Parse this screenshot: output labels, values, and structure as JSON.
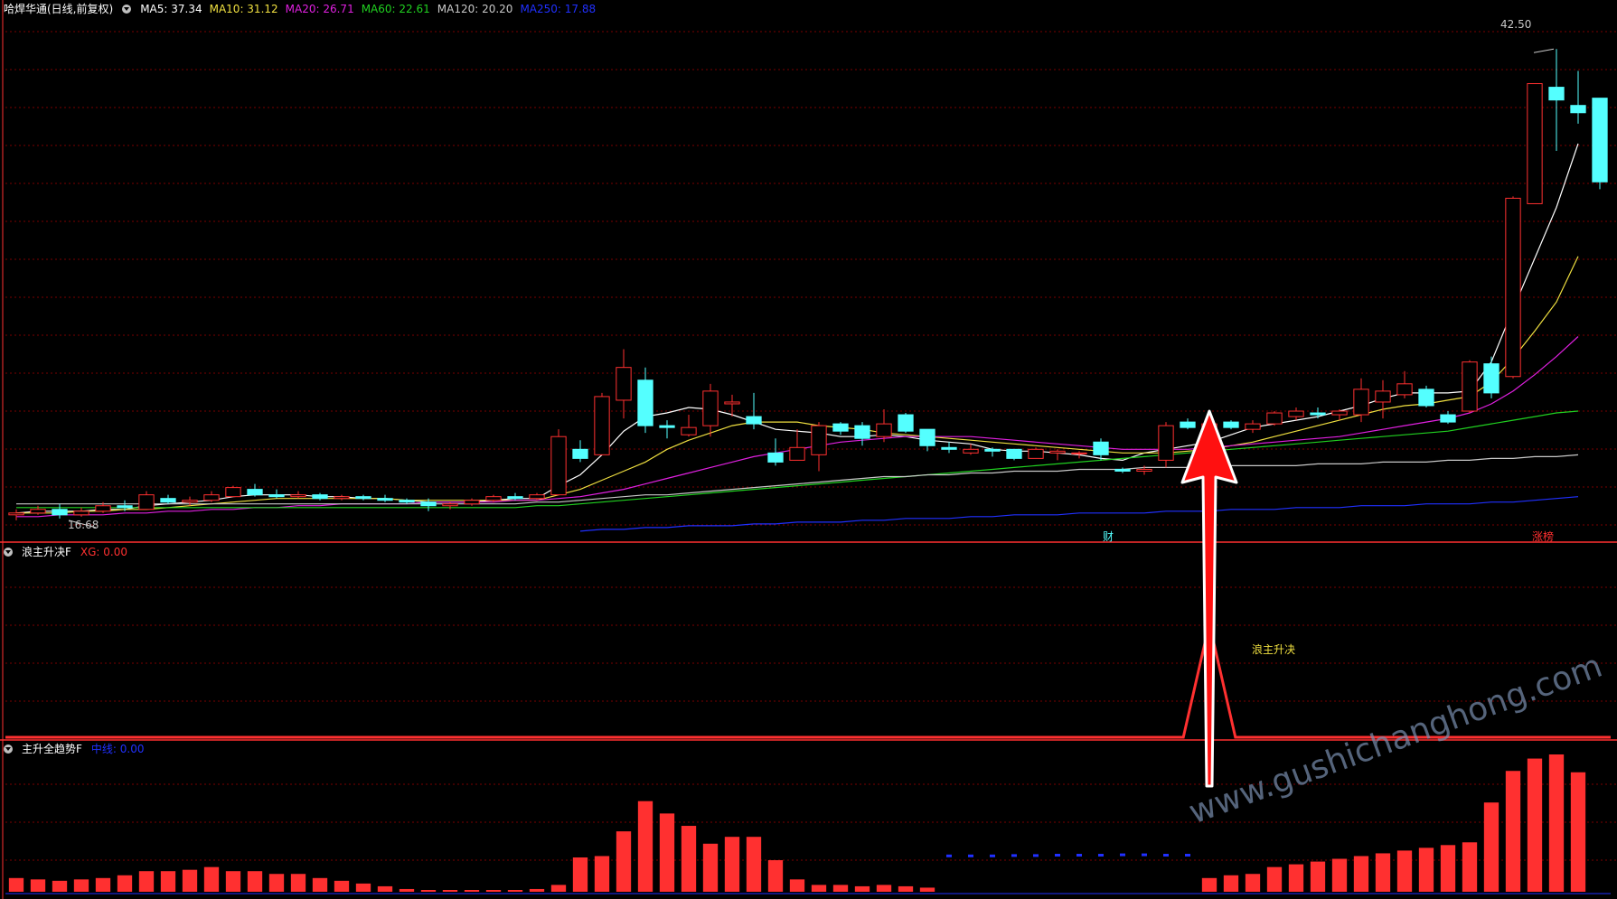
{
  "header": {
    "title": "哈焊华通(日线,前复权)",
    "ma_items": [
      {
        "label": "MA5: 37.34",
        "color": "#ffffff"
      },
      {
        "label": "MA10: 31.12",
        "color": "#f0e040"
      },
      {
        "label": "MA20: 26.71",
        "color": "#e020e0"
      },
      {
        "label": "MA60: 22.61",
        "color": "#20d020"
      },
      {
        "label": "MA120: 20.20",
        "color": "#c8c8c8"
      },
      {
        "label": "MA250: 17.88",
        "color": "#2030ff"
      }
    ]
  },
  "indicator1": {
    "name": "浪主升决F",
    "value_label": "XG: 0.00",
    "signal_text": "浪主升决"
  },
  "indicator2": {
    "name": "主升全趋势F",
    "value_label": "中线: 0.00"
  },
  "annotations": {
    "high_label": "42.50",
    "low_label": "16.68",
    "marker_cai": "财",
    "marker_zhangbang": "涨榜"
  },
  "watermark": "www.gushichanghong.com",
  "colors": {
    "up": "#ff3030",
    "down": "#54ffff",
    "grid": "#7a0000",
    "bg": "#000000"
  },
  "chart_data": {
    "type": "candlestick",
    "price_range": [
      15.5,
      44.5
    ],
    "candles": [
      {
        "o": 16.9,
        "h": 17.2,
        "l": 16.6,
        "c": 17.0
      },
      {
        "o": 17.0,
        "h": 17.4,
        "l": 16.9,
        "c": 17.2
      },
      {
        "o": 17.2,
        "h": 17.5,
        "l": 16.7,
        "c": 16.9
      },
      {
        "o": 16.9,
        "h": 17.3,
        "l": 16.8,
        "c": 17.1
      },
      {
        "o": 17.1,
        "h": 17.6,
        "l": 17.0,
        "c": 17.4
      },
      {
        "o": 17.4,
        "h": 17.7,
        "l": 17.1,
        "c": 17.3
      },
      {
        "o": 17.2,
        "h": 18.2,
        "l": 17.2,
        "c": 18.0
      },
      {
        "o": 17.8,
        "h": 18.0,
        "l": 17.5,
        "c": 17.6
      },
      {
        "o": 17.6,
        "h": 17.9,
        "l": 17.4,
        "c": 17.7
      },
      {
        "o": 17.7,
        "h": 18.2,
        "l": 17.6,
        "c": 18.0
      },
      {
        "o": 17.9,
        "h": 18.5,
        "l": 17.9,
        "c": 18.4
      },
      {
        "o": 18.3,
        "h": 18.6,
        "l": 17.9,
        "c": 18.0
      },
      {
        "o": 18.0,
        "h": 18.3,
        "l": 17.8,
        "c": 17.9
      },
      {
        "o": 17.9,
        "h": 18.2,
        "l": 17.8,
        "c": 18.0
      },
      {
        "o": 18.0,
        "h": 18.1,
        "l": 17.7,
        "c": 17.8
      },
      {
        "o": 17.8,
        "h": 18.0,
        "l": 17.7,
        "c": 17.9
      },
      {
        "o": 17.9,
        "h": 18.0,
        "l": 17.7,
        "c": 17.8
      },
      {
        "o": 17.8,
        "h": 18.0,
        "l": 17.6,
        "c": 17.7
      },
      {
        "o": 17.7,
        "h": 17.8,
        "l": 17.5,
        "c": 17.6
      },
      {
        "o": 17.6,
        "h": 17.8,
        "l": 17.1,
        "c": 17.4
      },
      {
        "o": 17.4,
        "h": 17.6,
        "l": 17.2,
        "c": 17.5
      },
      {
        "o": 17.5,
        "h": 17.8,
        "l": 17.4,
        "c": 17.7
      },
      {
        "o": 17.7,
        "h": 18.0,
        "l": 17.6,
        "c": 17.9
      },
      {
        "o": 17.9,
        "h": 18.1,
        "l": 17.7,
        "c": 17.8
      },
      {
        "o": 17.8,
        "h": 18.1,
        "l": 17.7,
        "c": 18.0
      },
      {
        "o": 18.0,
        "h": 21.6,
        "l": 18.0,
        "c": 21.2
      },
      {
        "o": 20.5,
        "h": 21.0,
        "l": 19.8,
        "c": 20.0
      },
      {
        "o": 20.2,
        "h": 23.6,
        "l": 20.2,
        "c": 23.4
      },
      {
        "o": 23.2,
        "h": 26.0,
        "l": 22.2,
        "c": 25.0
      },
      {
        "o": 24.3,
        "h": 25.0,
        "l": 21.4,
        "c": 21.8
      },
      {
        "o": 21.8,
        "h": 22.1,
        "l": 21.1,
        "c": 21.7
      },
      {
        "o": 21.3,
        "h": 22.4,
        "l": 21.2,
        "c": 21.7
      },
      {
        "o": 21.8,
        "h": 24.1,
        "l": 21.2,
        "c": 23.7
      },
      {
        "o": 23.0,
        "h": 23.5,
        "l": 22.3,
        "c": 23.1
      },
      {
        "o": 22.3,
        "h": 23.6,
        "l": 21.6,
        "c": 21.9
      },
      {
        "o": 20.3,
        "h": 21.1,
        "l": 19.6,
        "c": 19.8
      },
      {
        "o": 19.9,
        "h": 21.6,
        "l": 19.9,
        "c": 20.6
      },
      {
        "o": 20.2,
        "h": 22.0,
        "l": 19.3,
        "c": 21.8
      },
      {
        "o": 21.9,
        "h": 22.0,
        "l": 21.3,
        "c": 21.5
      },
      {
        "o": 21.8,
        "h": 22.0,
        "l": 20.7,
        "c": 21.1
      },
      {
        "o": 21.2,
        "h": 22.7,
        "l": 20.9,
        "c": 21.9
      },
      {
        "o": 22.4,
        "h": 22.5,
        "l": 21.4,
        "c": 21.5
      },
      {
        "o": 21.6,
        "h": 21.6,
        "l": 20.4,
        "c": 20.7
      },
      {
        "o": 20.6,
        "h": 20.9,
        "l": 20.3,
        "c": 20.5
      },
      {
        "o": 20.3,
        "h": 20.8,
        "l": 20.2,
        "c": 20.5
      },
      {
        "o": 20.5,
        "h": 20.6,
        "l": 20.1,
        "c": 20.4
      },
      {
        "o": 20.5,
        "h": 20.5,
        "l": 19.9,
        "c": 20.0
      },
      {
        "o": 20.0,
        "h": 20.6,
        "l": 20.0,
        "c": 20.5
      },
      {
        "o": 20.3,
        "h": 20.5,
        "l": 19.9,
        "c": 20.4
      },
      {
        "o": 20.3,
        "h": 20.4,
        "l": 20.0,
        "c": 20.3
      },
      {
        "o": 20.9,
        "h": 21.1,
        "l": 19.9,
        "c": 20.2
      },
      {
        "o": 19.4,
        "h": 19.5,
        "l": 19.2,
        "c": 19.3
      },
      {
        "o": 19.3,
        "h": 19.6,
        "l": 19.1,
        "c": 19.4
      },
      {
        "o": 19.9,
        "h": 22.0,
        "l": 19.5,
        "c": 21.8
      },
      {
        "o": 22.0,
        "h": 22.2,
        "l": 21.6,
        "c": 21.7
      },
      {
        "o": 21.3,
        "h": 22.0,
        "l": 21.1,
        "c": 21.9
      },
      {
        "o": 22.0,
        "h": 22.1,
        "l": 21.6,
        "c": 21.7
      },
      {
        "o": 21.6,
        "h": 22.1,
        "l": 21.4,
        "c": 21.9
      },
      {
        "o": 21.9,
        "h": 22.6,
        "l": 21.8,
        "c": 22.5
      },
      {
        "o": 22.3,
        "h": 22.8,
        "l": 22.1,
        "c": 22.6
      },
      {
        "o": 22.5,
        "h": 22.8,
        "l": 22.2,
        "c": 22.4
      },
      {
        "o": 22.4,
        "h": 22.7,
        "l": 22.1,
        "c": 22.6
      },
      {
        "o": 22.4,
        "h": 24.4,
        "l": 22.0,
        "c": 23.8
      },
      {
        "o": 23.1,
        "h": 24.3,
        "l": 22.2,
        "c": 23.7
      },
      {
        "o": 23.5,
        "h": 24.8,
        "l": 23.3,
        "c": 24.1
      },
      {
        "o": 23.8,
        "h": 24.0,
        "l": 22.8,
        "c": 22.9
      },
      {
        "o": 22.4,
        "h": 22.6,
        "l": 21.9,
        "c": 22.0
      },
      {
        "o": 22.6,
        "h": 25.4,
        "l": 22.5,
        "c": 25.3
      },
      {
        "o": 25.2,
        "h": 25.6,
        "l": 23.3,
        "c": 23.6
      },
      {
        "o": 24.5,
        "h": 34.4,
        "l": 24.4,
        "c": 34.3
      },
      {
        "o": 34.0,
        "h": 38.4,
        "l": 37.7,
        "c": 40.6
      },
      {
        "o": 40.4,
        "h": 42.5,
        "l": 36.9,
        "c": 39.7
      },
      {
        "o": 39.4,
        "h": 41.3,
        "l": 38.4,
        "c": 39.0
      },
      {
        "o": 39.8,
        "h": 39.8,
        "l": 34.8,
        "c": 35.2
      }
    ],
    "ma_lines": [
      {
        "name": "MA5",
        "color": "#ffffff",
        "values": [
          17.0,
          17.1,
          17.1,
          17.1,
          17.2,
          17.2,
          17.4,
          17.5,
          17.6,
          17.7,
          17.9,
          18.0,
          18.0,
          18.0,
          17.9,
          17.9,
          17.8,
          17.8,
          17.7,
          17.6,
          17.6,
          17.6,
          17.7,
          17.8,
          17.8,
          18.5,
          19.1,
          20.2,
          21.5,
          22.3,
          22.5,
          22.8,
          22.7,
          22.4,
          22.0,
          21.6,
          21.5,
          21.4,
          21.2,
          21.2,
          21.3,
          21.2,
          21.0,
          20.9,
          20.8,
          20.5,
          20.4,
          20.4,
          20.3,
          20.2,
          20.0,
          19.9,
          20.3,
          20.5,
          20.7,
          20.9,
          21.3,
          21.7,
          21.9,
          22.1,
          22.3,
          22.6,
          22.9,
          23.3,
          23.6,
          23.6,
          23.6,
          23.7,
          25.3,
          28.2,
          31.0,
          33.8,
          37.3
        ]
      },
      {
        "name": "MA10",
        "color": "#f0e040",
        "values": [
          17.0,
          17.0,
          17.0,
          17.1,
          17.1,
          17.2,
          17.2,
          17.3,
          17.4,
          17.5,
          17.6,
          17.7,
          17.8,
          17.8,
          17.8,
          17.8,
          17.8,
          17.8,
          17.7,
          17.7,
          17.7,
          17.7,
          17.7,
          17.7,
          17.7,
          18.0,
          18.3,
          18.8,
          19.3,
          19.8,
          20.5,
          21.0,
          21.4,
          21.8,
          22.0,
          22.0,
          22.0,
          21.8,
          21.7,
          21.6,
          21.4,
          21.3,
          21.2,
          21.1,
          21.0,
          20.9,
          20.8,
          20.7,
          20.6,
          20.5,
          20.4,
          20.3,
          20.3,
          20.3,
          20.4,
          20.5,
          20.7,
          20.9,
          21.2,
          21.5,
          21.8,
          22.1,
          22.4,
          22.7,
          22.9,
          23.0,
          23.2,
          23.4,
          24.2,
          25.5,
          27.0,
          28.6,
          31.1
        ]
      },
      {
        "name": "MA20",
        "color": "#e020e0",
        "values": [
          16.8,
          16.8,
          16.9,
          16.9,
          16.9,
          17.0,
          17.0,
          17.1,
          17.1,
          17.2,
          17.2,
          17.3,
          17.3,
          17.4,
          17.4,
          17.5,
          17.5,
          17.5,
          17.5,
          17.6,
          17.6,
          17.6,
          17.6,
          17.7,
          17.7,
          17.8,
          17.9,
          18.1,
          18.3,
          18.6,
          18.9,
          19.2,
          19.5,
          19.8,
          20.1,
          20.3,
          20.5,
          20.7,
          20.9,
          21.0,
          21.1,
          21.2,
          21.2,
          21.2,
          21.2,
          21.1,
          21.0,
          20.9,
          20.8,
          20.7,
          20.6,
          20.5,
          20.5,
          20.5,
          20.5,
          20.6,
          20.7,
          20.8,
          20.9,
          21.0,
          21.1,
          21.2,
          21.4,
          21.6,
          21.8,
          22.0,
          22.2,
          22.5,
          23.0,
          23.7,
          24.6,
          25.6,
          26.7
        ]
      },
      {
        "name": "MA60",
        "color": "#20d020",
        "values": [
          17.3,
          17.3,
          17.3,
          17.3,
          17.3,
          17.3,
          17.3,
          17.3,
          17.3,
          17.3,
          17.3,
          17.3,
          17.3,
          17.3,
          17.3,
          17.3,
          17.3,
          17.3,
          17.3,
          17.3,
          17.3,
          17.3,
          17.3,
          17.3,
          17.4,
          17.4,
          17.5,
          17.6,
          17.7,
          17.8,
          17.9,
          18.0,
          18.1,
          18.2,
          18.3,
          18.4,
          18.5,
          18.6,
          18.7,
          18.8,
          18.9,
          19.0,
          19.1,
          19.2,
          19.3,
          19.4,
          19.5,
          19.6,
          19.7,
          19.8,
          19.9,
          20.0,
          20.1,
          20.2,
          20.3,
          20.4,
          20.5,
          20.6,
          20.7,
          20.8,
          20.9,
          21.0,
          21.1,
          21.2,
          21.3,
          21.4,
          21.5,
          21.7,
          21.9,
          22.1,
          22.3,
          22.5,
          22.6
        ]
      },
      {
        "name": "MA120",
        "color": "#c8c8c8",
        "values": [
          17.5,
          17.5,
          17.5,
          17.5,
          17.5,
          17.5,
          17.5,
          17.5,
          17.5,
          17.5,
          17.5,
          17.5,
          17.5,
          17.5,
          17.5,
          17.5,
          17.5,
          17.5,
          17.5,
          17.5,
          17.5,
          17.5,
          17.5,
          17.5,
          17.6,
          17.6,
          17.7,
          17.8,
          17.9,
          18.0,
          18.0,
          18.1,
          18.2,
          18.3,
          18.4,
          18.5,
          18.6,
          18.7,
          18.8,
          18.9,
          19.0,
          19.0,
          19.1,
          19.1,
          19.2,
          19.2,
          19.3,
          19.3,
          19.3,
          19.4,
          19.4,
          19.4,
          19.5,
          19.5,
          19.5,
          19.5,
          19.6,
          19.6,
          19.6,
          19.6,
          19.7,
          19.7,
          19.7,
          19.8,
          19.8,
          19.8,
          19.9,
          19.9,
          20.0,
          20.0,
          20.1,
          20.1,
          20.2
        ]
      },
      {
        "name": "MA250",
        "color": "#2030ff",
        "values": [
          null,
          null,
          null,
          null,
          null,
          null,
          null,
          null,
          null,
          null,
          null,
          null,
          null,
          null,
          null,
          null,
          null,
          null,
          null,
          null,
          null,
          null,
          null,
          null,
          null,
          null,
          16.0,
          16.1,
          16.1,
          16.2,
          16.2,
          16.3,
          16.3,
          16.3,
          16.4,
          16.4,
          16.5,
          16.5,
          16.5,
          16.6,
          16.6,
          16.7,
          16.7,
          16.7,
          16.8,
          16.8,
          16.9,
          16.9,
          16.9,
          17.0,
          17.0,
          17.0,
          17.0,
          17.1,
          17.1,
          17.1,
          17.2,
          17.2,
          17.2,
          17.3,
          17.3,
          17.3,
          17.4,
          17.4,
          17.4,
          17.5,
          17.5,
          17.5,
          17.6,
          17.6,
          17.7,
          17.8,
          17.9
        ]
      }
    ],
    "signal_series": {
      "spike_index": 55,
      "range": [
        0,
        1
      ]
    },
    "trend_bars": {
      "range": [
        0,
        10
      ],
      "values": [
        1.0,
        0.9,
        0.8,
        0.9,
        1.0,
        1.2,
        1.5,
        1.5,
        1.6,
        1.8,
        1.5,
        1.5,
        1.3,
        1.3,
        1.0,
        0.8,
        0.6,
        0.4,
        0.2,
        0.1,
        0.1,
        0.1,
        0.1,
        0.1,
        0.2,
        0.5,
        2.5,
        2.6,
        4.4,
        6.6,
        5.7,
        4.8,
        3.5,
        4.0,
        4.0,
        2.3,
        0.9,
        0.5,
        0.5,
        0.4,
        0.5,
        0.4,
        0.3,
        -0.3,
        -0.3,
        -0.3,
        -0.4,
        -0.4,
        -0.5,
        -0.5,
        -0.5,
        -0.6,
        -0.6,
        -0.5,
        -0.5,
        1.0,
        1.2,
        1.3,
        1.8,
        2.0,
        2.2,
        2.4,
        2.6,
        2.8,
        3.0,
        3.2,
        3.4,
        3.6,
        6.5,
        8.8,
        9.7,
        10.0,
        8.7
      ],
      "colors_note": "red bars positive; small blue dashes negative"
    }
  }
}
